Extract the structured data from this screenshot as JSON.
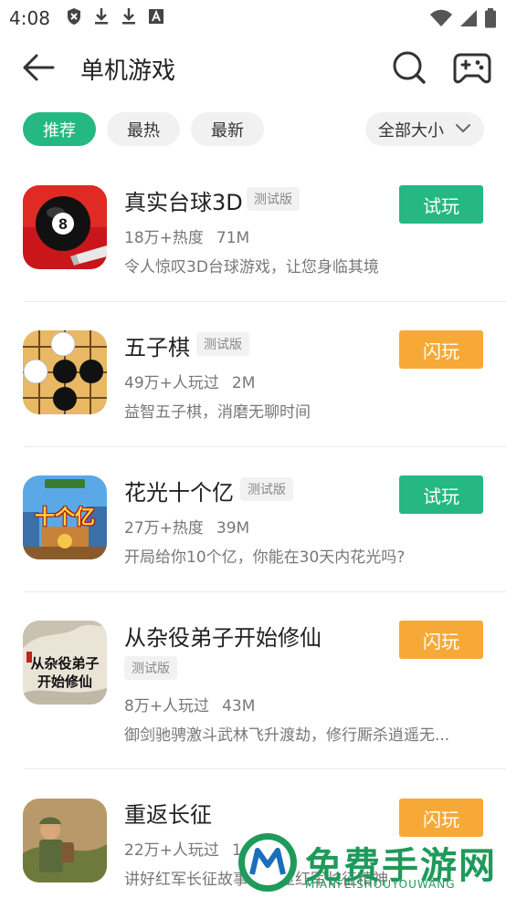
{
  "status_bar": {
    "time": "4:08",
    "left_icons": [
      "shield-badge-icon",
      "download-icon",
      "download-icon",
      "font-a-icon"
    ],
    "right_icons": [
      "wifi-icon",
      "signal-icon",
      "battery-icon"
    ]
  },
  "header": {
    "title": "单机游戏"
  },
  "filters": {
    "chips": [
      {
        "label": "推荐",
        "active": true
      },
      {
        "label": "最热",
        "active": false
      },
      {
        "label": "最新",
        "active": false
      }
    ],
    "sort": {
      "label": "全部大小"
    }
  },
  "games": [
    {
      "name": "真实台球3D",
      "tag": "测试版",
      "stat": "18万+热度",
      "size": "71M",
      "desc": "令人惊叹3D台球游戏，让您身临其境",
      "button": "试玩",
      "button_color": "#25b883"
    },
    {
      "name": "五子棋",
      "tag": "测试版",
      "stat": "49万+人玩过",
      "size": "2M",
      "desc": "益智五子棋，消磨无聊时间",
      "button": "闪玩",
      "button_color": "#f7a938"
    },
    {
      "name": "花光十个亿",
      "tag": "测试版",
      "stat": "27万+热度",
      "size": "39M",
      "desc": "开局给你10个亿，你能在30天内花光吗?",
      "button": "试玩",
      "button_color": "#25b883",
      "icon_text": "十个亿"
    },
    {
      "name": "从杂役弟子开始修仙",
      "tag": "测试版",
      "stat": "8万+人玩过",
      "size": "43M",
      "desc": "御剑驰骋激斗武林飞升渡劫，修行厮杀逍遥无...",
      "button": "闪玩",
      "button_color": "#f7a938",
      "icon_text_1": "从杂役弟子",
      "icon_text_2": "开始修仙"
    },
    {
      "name": "重返长征",
      "tag": "",
      "stat": "22万+人玩过",
      "size": "1",
      "desc": "讲好红军长征故事，彰显红军长征精神",
      "button": "闪玩",
      "button_color": "#f7a938"
    }
  ],
  "watermark": {
    "text": "免费手游网",
    "sub": "MIANFEISHOUYOUWANG"
  },
  "colors": {
    "accent_green": "#25b883",
    "accent_orange": "#f7a938"
  }
}
